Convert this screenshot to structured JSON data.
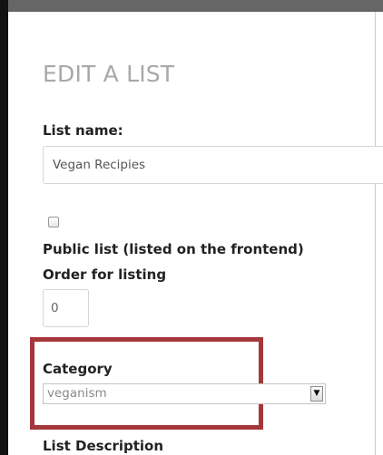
{
  "form": {
    "title": "EDIT A LIST",
    "list_name_label": "List name:",
    "list_name_value": "Vegan Recipies",
    "public_list_label": "Public list (listed on the frontend)",
    "public_list_checked": false,
    "order_label": "Order for listing",
    "order_value": "0",
    "category_label": "Category",
    "category_selected": "veganism",
    "description_label": "List Description"
  },
  "icons": {
    "select_arrow": "chevron-down-icon"
  },
  "colors": {
    "highlight": "#a5373b",
    "title": "#a8a8a8",
    "label": "#222222"
  }
}
